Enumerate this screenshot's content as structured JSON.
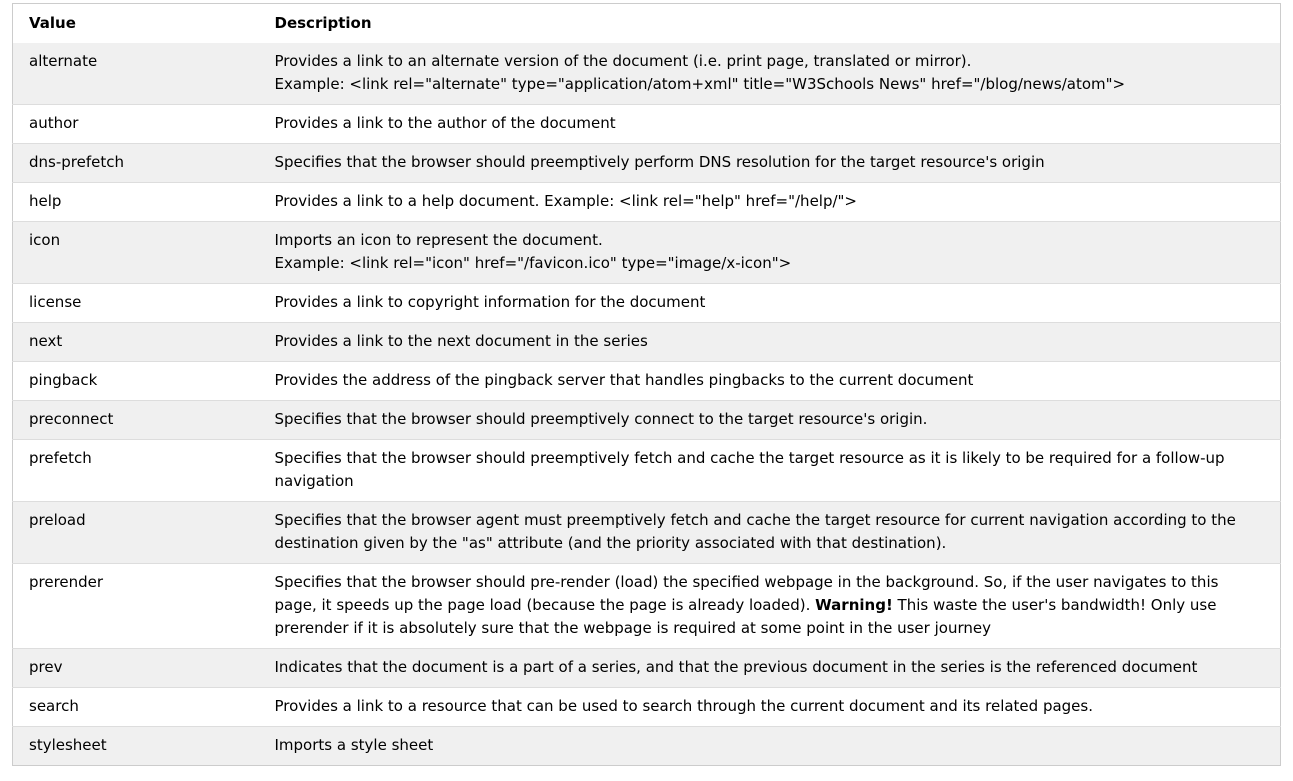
{
  "table": {
    "headers": [
      "Value",
      "Description"
    ],
    "rows": [
      {
        "value": "alternate",
        "lines": [
          "Provides a link to an alternate version of the document (i.e. print page, translated or mirror).",
          "Example: <link rel=\"alternate\" type=\"application/atom+xml\" title=\"W3Schools News\" href=\"/blog/news/atom\">"
        ]
      },
      {
        "value": "author",
        "lines": [
          "Provides a link to the author of the document"
        ]
      },
      {
        "value": "dns-prefetch",
        "lines": [
          "Specifies that the browser should preemptively perform DNS resolution for the target resource's origin"
        ]
      },
      {
        "value": "help",
        "lines": [
          "Provides a link to a help document. Example: <link rel=\"help\" href=\"/help/\">"
        ]
      },
      {
        "value": "icon",
        "lines": [
          "Imports an icon to represent the document.",
          "Example: <link rel=\"icon\" href=\"/favicon.ico\" type=\"image/x-icon\">"
        ]
      },
      {
        "value": "license",
        "lines": [
          "Provides a link to copyright information for the document"
        ]
      },
      {
        "value": "next",
        "lines": [
          "Provides a link to the next document in the series"
        ]
      },
      {
        "value": "pingback",
        "lines": [
          "Provides the address of the pingback server that handles pingbacks to the current document"
        ]
      },
      {
        "value": "preconnect",
        "lines": [
          "Specifies that the browser should preemptively connect to the target resource's origin."
        ]
      },
      {
        "value": "prefetch",
        "lines": [
          "Specifies that the browser should preemptively fetch and cache the target resource as it is likely to be required for a follow-up navigation"
        ]
      },
      {
        "value": "preload",
        "lines": [
          "Specifies that the browser agent must preemptively fetch and cache the target resource for current navigation according to the destination given by the \"as\" attribute (and the priority associated with that destination)."
        ]
      },
      {
        "value": "prerender",
        "desc_before": "Specifies that the browser should pre-render (load) the specified webpage in the background. So, if the user navigates to this page, it speeds up the page load (because the page is already loaded). ",
        "warning": "Warning!",
        "desc_after": " This waste the user's bandwidth! Only use prerender if it is absolutely sure that the webpage is required at some point in the user journey"
      },
      {
        "value": "prev",
        "lines": [
          "Indicates that the document is a part of a series, and that the previous document in the series is the referenced document"
        ]
      },
      {
        "value": "search",
        "lines": [
          "Provides a link to a resource that can be used to search through the current document and its related pages."
        ]
      },
      {
        "value": "stylesheet",
        "lines": [
          "Imports a style sheet"
        ]
      }
    ]
  }
}
